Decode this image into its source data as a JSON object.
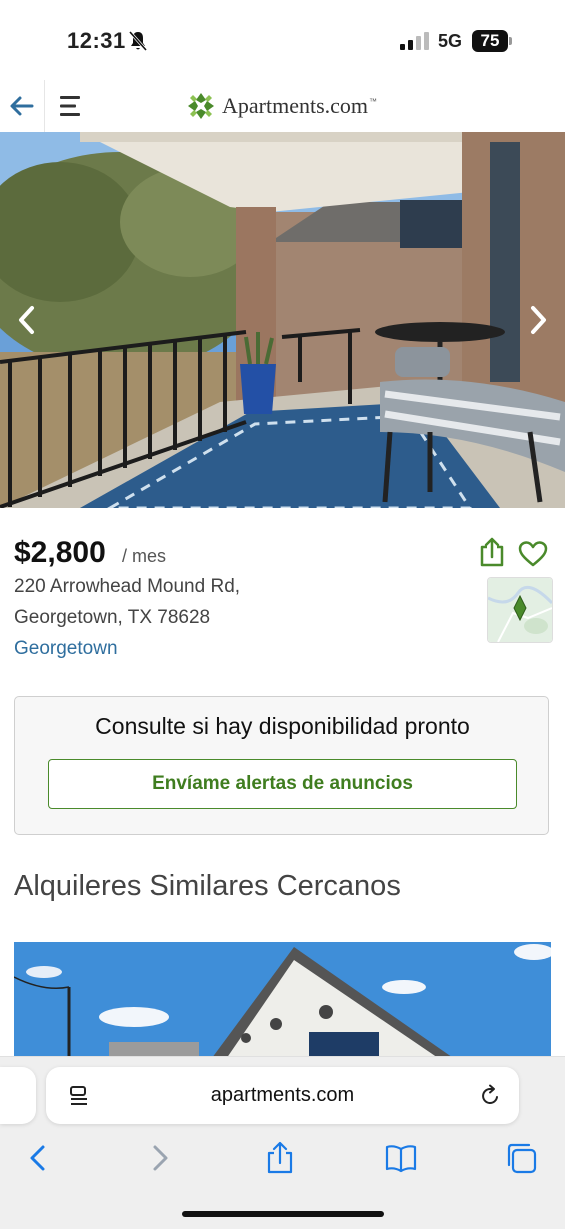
{
  "status_bar": {
    "time": "12:31",
    "network": "5G",
    "battery": "75"
  },
  "header": {
    "logo_text": "Apartments.com",
    "logo_tm": "™"
  },
  "listing": {
    "price": "$2,800",
    "per": "/ mes",
    "address_line1": "220 Arrowhead Mound Rd,",
    "address_line2": "Georgetown, TX 78628",
    "neighborhood": "Georgetown"
  },
  "availability": {
    "title": "Consulte si hay disponibilidad pronto",
    "button_label": "Envíame alertas de anuncios"
  },
  "similar": {
    "heading": "Alquileres Similares Cercanos"
  },
  "browser": {
    "url": "apartments.com"
  },
  "colors": {
    "brand_green": "#4a8a2b",
    "link_blue": "#2f6e9e",
    "ios_blue": "#1a7ae6"
  }
}
